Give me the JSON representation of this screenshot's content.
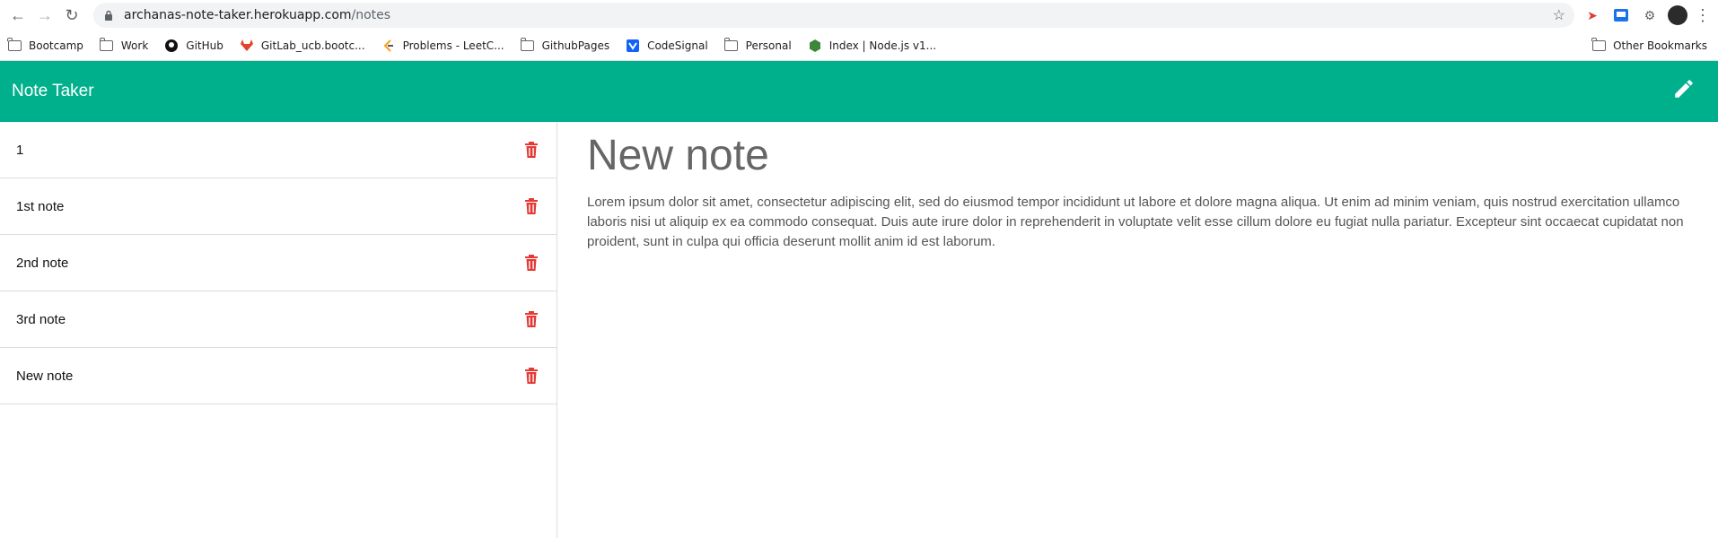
{
  "browser": {
    "url_host": "archanas-note-taker.herokuapp.com",
    "url_path": "/notes"
  },
  "bookmarks": [
    {
      "label": "Bootcamp",
      "icon": "folder-icon"
    },
    {
      "label": "Work",
      "icon": "folder-icon"
    },
    {
      "label": "GitHub",
      "icon": "github-icon"
    },
    {
      "label": "GitLab_ucb.bootc...",
      "icon": "gitlab-icon"
    },
    {
      "label": "Problems - LeetC...",
      "icon": "leetcode-icon"
    },
    {
      "label": "GithubPages",
      "icon": "folder-icon"
    },
    {
      "label": "CodeSignal",
      "icon": "codesignal-icon"
    },
    {
      "label": "Personal",
      "icon": "folder-icon"
    },
    {
      "label": "Index | Node.js v1...",
      "icon": "nodejs-icon"
    }
  ],
  "other_bookmarks": "Other Bookmarks",
  "app": {
    "title": "Note Taker",
    "accent": "#00b08d"
  },
  "notes": [
    {
      "title": "1"
    },
    {
      "title": "1st note"
    },
    {
      "title": "2nd note"
    },
    {
      "title": "3rd note"
    },
    {
      "title": "New note"
    }
  ],
  "active_note": {
    "title": "New note",
    "text": "Lorem ipsum dolor sit amet, consectetur adipiscing elit, sed do eiusmod tempor incididunt ut labore et dolore magna aliqua. Ut enim ad minim veniam, quis nostrud exercitation ullamco laboris nisi ut aliquip ex ea commodo consequat. Duis aute irure dolor in reprehenderit in voluptate velit esse cillum dolore eu fugiat nulla pariatur. Excepteur sint occaecat cupidatat non proident, sunt in culpa qui officia deserunt mollit anim id est laborum."
  }
}
